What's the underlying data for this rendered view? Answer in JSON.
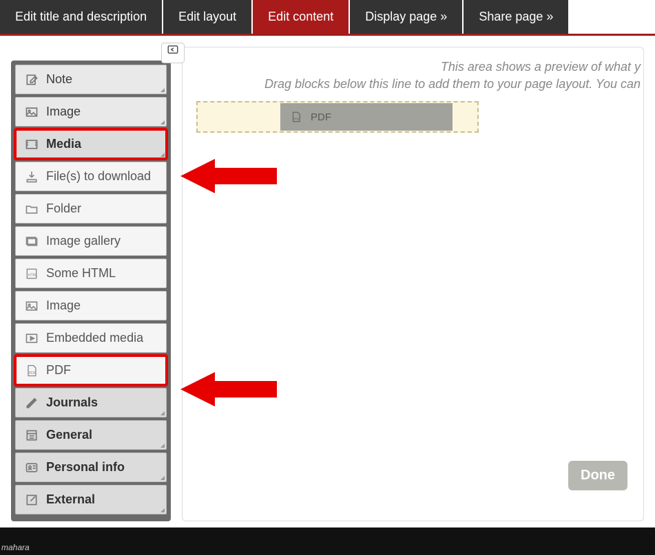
{
  "tabs": {
    "edit_title": "Edit title and description",
    "edit_layout": "Edit layout",
    "edit_content": "Edit content",
    "display_page": "Display page »",
    "share_page": "Share page »"
  },
  "sidebar": {
    "note": "Note",
    "image_top": "Image",
    "media": "Media",
    "files_download": "File(s) to download",
    "folder": "Folder",
    "image_gallery": "Image gallery",
    "some_html": "Some HTML",
    "image_sub": "Image",
    "embedded_media": "Embedded media",
    "pdf": "PDF",
    "journals": "Journals",
    "general": "General",
    "personal_info": "Personal info",
    "external": "External"
  },
  "preview": {
    "hint1": "This area shows a preview of what y",
    "hint2": "Drag blocks below this line to add them to your page layout. You can",
    "chip_label": "PDF"
  },
  "done_label": "Done",
  "collapse_icon": "⬅"
}
